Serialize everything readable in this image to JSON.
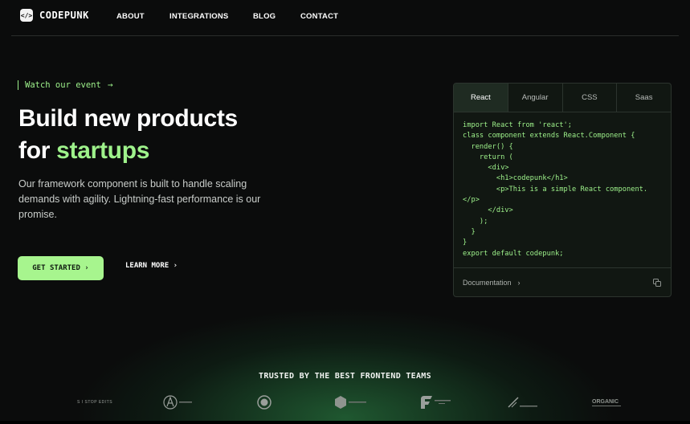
{
  "app": {
    "logo_glyph": "</>",
    "name": "CODEPUNK"
  },
  "nav": {
    "items": [
      "ABOUT",
      "INTEGRATIONS",
      "BLOG",
      "CONTACT"
    ]
  },
  "hero": {
    "event_link": "Watch our event",
    "title_line1": "Build new products",
    "title_line2_prefix": "for ",
    "title_line2_highlight": "startups",
    "subtitle": "Our framework component is built to handle scaling demands with agility. Lightning-fast performance is our promise.",
    "cta_primary": "GET STARTED ›",
    "cta_secondary": "LEARN MORE ›"
  },
  "code_card": {
    "tabs": [
      "React",
      "Angular",
      "CSS",
      "Saas"
    ],
    "active_tab": "React",
    "code": "import React from 'react';\nclass component extends React.Component {\n  render() {\n    return (\n      <div>\n        <h1>codepunk</h1>\n        <p>This is a simple React component.\n</p>\n      </div>\n    );\n  }\n}\nexport default codepunk;",
    "footer_link": "Documentation",
    "footer_chevron": "›"
  },
  "trusted": {
    "heading": "TRUSTED BY THE BEST FRONTEND TEAMS",
    "logos": [
      {
        "name": "stop-edits-logo",
        "text": "S I STOP EDITS"
      },
      {
        "name": "a-circle-logo",
        "text": ""
      },
      {
        "name": "crest-logo",
        "text": ""
      },
      {
        "name": "cube-logo",
        "text": ""
      },
      {
        "name": "f-logo",
        "text": ""
      },
      {
        "name": "swoosh-logo",
        "text": ""
      },
      {
        "name": "organic-logo",
        "text": "ORGANIC"
      }
    ]
  },
  "colors": {
    "accent": "#9ef28b",
    "button": "#a7f58e",
    "background": "#0b0c0c"
  }
}
